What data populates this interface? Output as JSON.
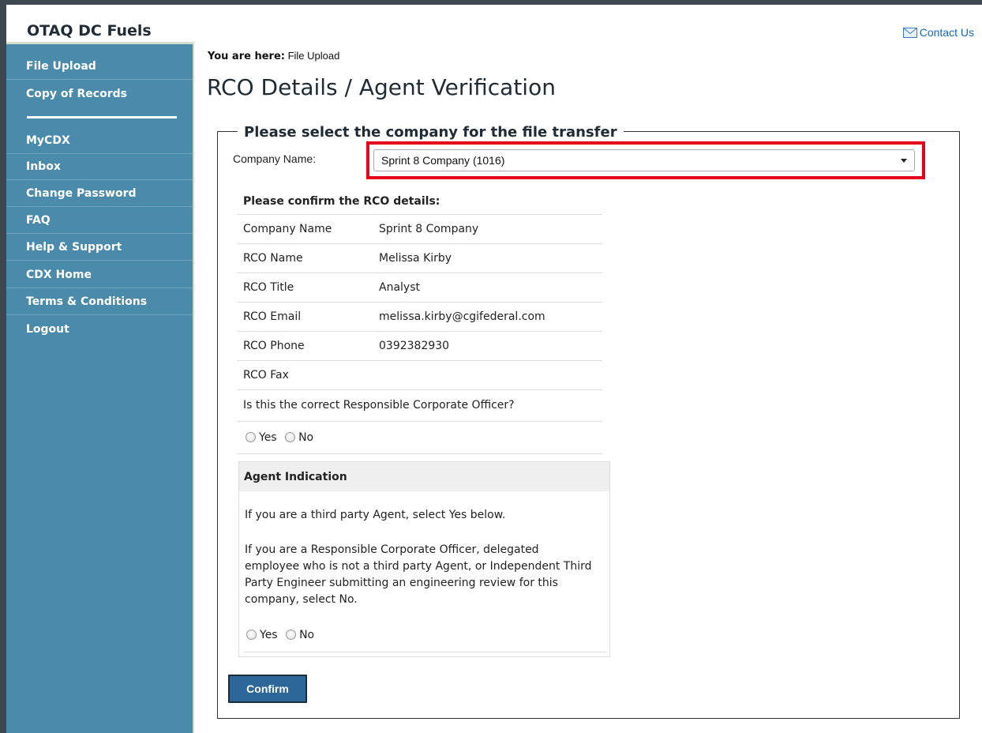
{
  "app": {
    "title": "OTAQ DC Fuels"
  },
  "header": {
    "contact_label": "Contact Us"
  },
  "sidebar": {
    "items": [
      {
        "label": "File Upload"
      },
      {
        "label": "Copy of Records"
      },
      {
        "label": "MyCDX"
      },
      {
        "label": "Inbox"
      },
      {
        "label": "Change Password"
      },
      {
        "label": "FAQ"
      },
      {
        "label": "Help & Support"
      },
      {
        "label": "CDX Home"
      },
      {
        "label": "Terms & Conditions"
      },
      {
        "label": "Logout"
      }
    ]
  },
  "breadcrumb": {
    "prefix": "You are here",
    "current": "File Upload"
  },
  "page": {
    "title": "RCO Details / Agent Verification"
  },
  "form": {
    "legend": "Please select the company for the file transfer",
    "company_label": "Company Name:",
    "company_selected": "Sprint 8 Company (1016)"
  },
  "rco": {
    "heading": "Please confirm the RCO details:",
    "rows": [
      {
        "label": "Company Name",
        "value": "Sprint 8 Company"
      },
      {
        "label": "RCO Name",
        "value": "Melissa Kirby"
      },
      {
        "label": "RCO Title",
        "value": "Analyst"
      },
      {
        "label": "RCO Email",
        "value": "melissa.kirby@cgifederal.com"
      },
      {
        "label": "RCO Phone",
        "value": "0392382930"
      },
      {
        "label": "RCO Fax",
        "value": ""
      }
    ],
    "question": "Is this the correct Responsible Corporate Officer?",
    "yes_label": "Yes",
    "no_label": "No"
  },
  "agent": {
    "header": "Agent Indication",
    "text1": "If you are a third party Agent, select Yes below.",
    "text2": "If you are a Responsible Corporate Officer, delegated employee who is not a third party Agent, or Independent Third Party Engineer submitting an engineering review for this company, select No.",
    "yes_label": "Yes",
    "no_label": "No"
  },
  "actions": {
    "confirm_label": "Confirm"
  },
  "colors": {
    "sidebar_bg": "#4a8aab",
    "highlight": "#e3001b",
    "button_bg": "#2d6799",
    "link": "#1a66b3"
  }
}
